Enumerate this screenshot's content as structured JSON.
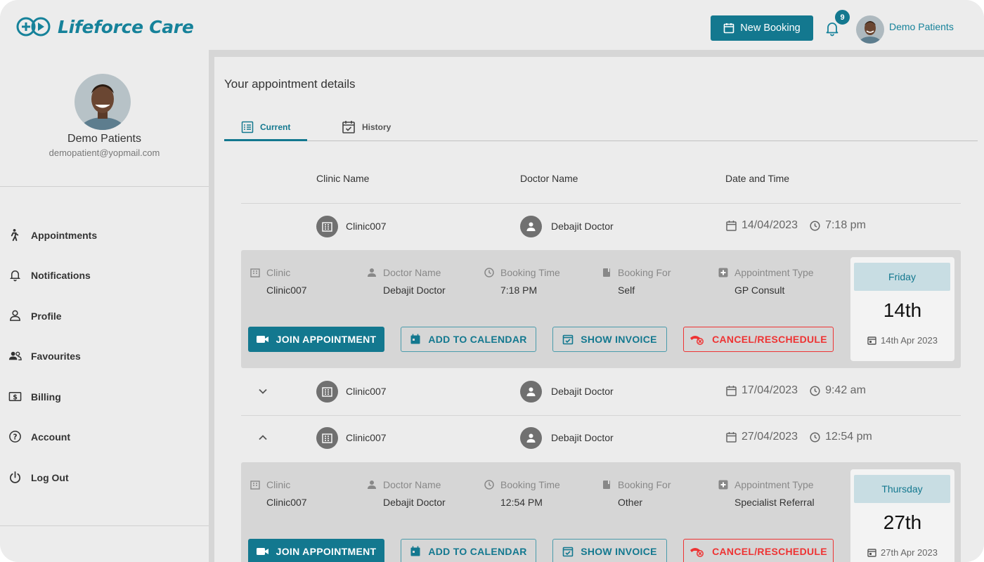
{
  "app": {
    "name": "Lifeforce Care",
    "new_booking_label": "New Booking",
    "notification_count": "9",
    "user_name": "Demo Patients"
  },
  "sidebar": {
    "profile_name": "Demo Patients",
    "profile_email": "demopatient@yopmail.com",
    "items": [
      {
        "label": "Appointments",
        "icon": "walking-person-icon"
      },
      {
        "label": "Notifications",
        "icon": "bell-icon"
      },
      {
        "label": "Profile",
        "icon": "person-icon"
      },
      {
        "label": "Favourites",
        "icon": "people-icon"
      },
      {
        "label": "Billing",
        "icon": "dollar-icon"
      },
      {
        "label": "Account",
        "icon": "help-circle-icon"
      },
      {
        "label": "Log Out",
        "icon": "power-icon"
      }
    ]
  },
  "main": {
    "title": "Your appointment details",
    "tabs": [
      {
        "label": "Current",
        "icon": "list-icon"
      },
      {
        "label": "History",
        "icon": "calendar-check-icon"
      }
    ],
    "columns": {
      "clinic": "Clinic Name",
      "doctor": "Doctor Name",
      "datetime": "Date and Time"
    },
    "appointments": [
      {
        "clinic": "Clinic007",
        "doctor": "Debajit Doctor",
        "date": "14/04/2023",
        "time": "7:18 pm"
      },
      {
        "clinic": "Clinic007",
        "doctor": "Debajit Doctor",
        "date": "17/04/2023",
        "time": "9:42 am"
      },
      {
        "clinic": "Clinic007",
        "doctor": "Debajit Doctor",
        "date": "27/04/2023",
        "time": "12:54 pm"
      }
    ],
    "detail_labels": {
      "clinic": "Clinic",
      "doctor": "Doctor Name",
      "booking_time": "Booking Time",
      "booking_for": "Booking For",
      "appointment_type": "Appointment Type"
    },
    "actions": {
      "join": "JOIN APPOINTMENT",
      "calendar": "ADD TO CALENDAR",
      "invoice": "SHOW INVOICE",
      "cancel": "CANCEL/RESCHEDULE"
    },
    "details": [
      {
        "clinic": "Clinic007",
        "doctor": "Debajit Doctor",
        "booking_time": "7:18 PM",
        "booking_for": "Self",
        "appointment_type": "GP Consult",
        "day_name": "Friday",
        "day_num": "14th",
        "full_date": "14th Apr 2023"
      },
      {
        "clinic": "Clinic007",
        "doctor": "Debajit Doctor",
        "booking_time": "12:54 PM",
        "booking_for": "Other",
        "appointment_type": "Specialist Referral",
        "day_name": "Thursday",
        "day_num": "27th",
        "full_date": "27th Apr 2023"
      }
    ]
  },
  "colors": {
    "brand": "#13788f",
    "danger": "#ee3333",
    "background": "#ececec"
  }
}
